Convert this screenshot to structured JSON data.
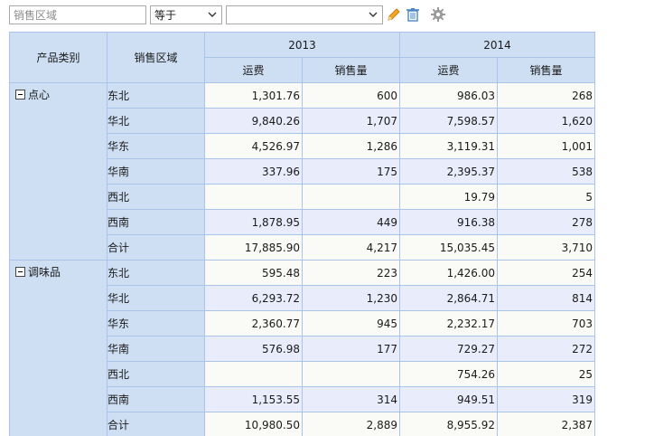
{
  "filter": {
    "field_placeholder": "销售区域",
    "operator": "等于",
    "value": ""
  },
  "icons": {
    "edit": "pencil-icon",
    "delete": "trash-icon",
    "settings": "gear-icon",
    "accent_edit": "#f5a623",
    "accent_delete": "#4a86c8"
  },
  "table": {
    "dim_headers": [
      "产品类别",
      "销售区域"
    ],
    "years": [
      "2013",
      "2014"
    ],
    "measures": [
      "运费",
      "销售量"
    ],
    "groups": [
      {
        "category": "点心",
        "rows": [
          {
            "region": "东北",
            "v": [
              "1,301.76",
              "600",
              "986.03",
              "268"
            ]
          },
          {
            "region": "华北",
            "v": [
              "9,840.26",
              "1,707",
              "7,598.57",
              "1,620"
            ]
          },
          {
            "region": "华东",
            "v": [
              "4,526.97",
              "1,286",
              "3,119.31",
              "1,001"
            ]
          },
          {
            "region": "华南",
            "v": [
              "337.96",
              "175",
              "2,395.37",
              "538"
            ]
          },
          {
            "region": "西北",
            "v": [
              "",
              "",
              "19.79",
              "5"
            ]
          },
          {
            "region": "西南",
            "v": [
              "1,878.95",
              "449",
              "916.38",
              "278"
            ]
          },
          {
            "region": "合计",
            "v": [
              "17,885.90",
              "4,217",
              "15,035.45",
              "3,710"
            ]
          }
        ]
      },
      {
        "category": "调味品",
        "rows": [
          {
            "region": "东北",
            "v": [
              "595.48",
              "223",
              "1,426.00",
              "254"
            ]
          },
          {
            "region": "华北",
            "v": [
              "6,293.72",
              "1,230",
              "2,864.71",
              "814"
            ]
          },
          {
            "region": "华东",
            "v": [
              "2,360.77",
              "945",
              "2,232.17",
              "703"
            ]
          },
          {
            "region": "华南",
            "v": [
              "576.98",
              "177",
              "729.27",
              "272"
            ]
          },
          {
            "region": "西北",
            "v": [
              "",
              "",
              "754.26",
              "25"
            ]
          },
          {
            "region": "西南",
            "v": [
              "1,153.55",
              "314",
              "949.51",
              "319"
            ]
          },
          {
            "region": "合计",
            "v": [
              "10,980.50",
              "2,889",
              "8,955.92",
              "2,387"
            ]
          }
        ]
      }
    ]
  }
}
